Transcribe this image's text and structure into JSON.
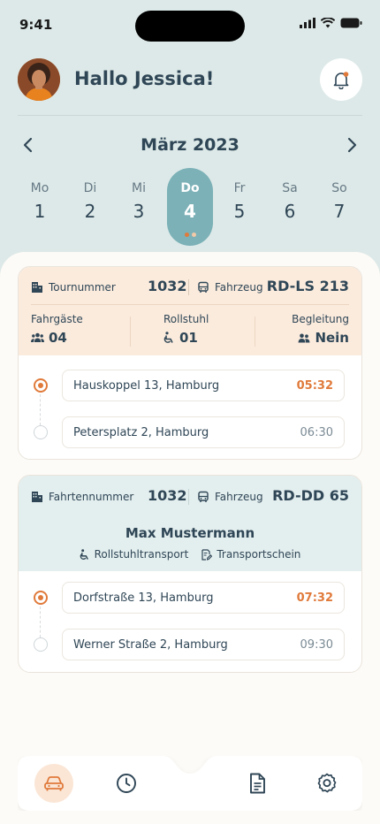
{
  "status": {
    "time": "9:41"
  },
  "header": {
    "greeting": "Hallo Jessica!"
  },
  "calendar": {
    "month": "März 2023",
    "days": [
      {
        "name": "Mo",
        "date": "1"
      },
      {
        "name": "Di",
        "date": "2"
      },
      {
        "name": "Mi",
        "date": "3"
      },
      {
        "name": "Do",
        "date": "4"
      },
      {
        "name": "Fr",
        "date": "5"
      },
      {
        "name": "Sa",
        "date": "6"
      },
      {
        "name": "So",
        "date": "7"
      }
    ],
    "active_index": 3
  },
  "tour_card": {
    "number_label": "Tournummer",
    "number": "1032",
    "vehicle_label": "Fahrzeug",
    "plate": "RD-LS 213",
    "stats": [
      {
        "label": "Fahrgäste",
        "value": "04",
        "icon": "people-icon"
      },
      {
        "label": "Rollstuhl",
        "value": "01",
        "icon": "wheelchair-icon"
      },
      {
        "label": "Begleitung",
        "value": "Nein",
        "icon": "companion-icon"
      }
    ],
    "stops": [
      {
        "address": "Hauskoppel 13, Hamburg",
        "time": "05:32"
      },
      {
        "address": "Petersplatz 2, Hamburg",
        "time": "06:30"
      }
    ]
  },
  "trip_card": {
    "number_label": "Fahrtennummer",
    "number": "1032",
    "vehicle_label": "Fahrzeug",
    "plate": "RD-DD 65",
    "person": "Max Mustermann",
    "tags": [
      "Rollstuhltransport",
      "Transportschein"
    ],
    "stops": [
      {
        "address": "Dorfstraße 13, Hamburg",
        "time": "07:32"
      },
      {
        "address": "Werner Straße 2, Hamburg",
        "time": "09:30"
      }
    ]
  },
  "colors": {
    "accent": "#e07a3b",
    "teal": "#7bb1b7",
    "background": "#dde9e8"
  }
}
